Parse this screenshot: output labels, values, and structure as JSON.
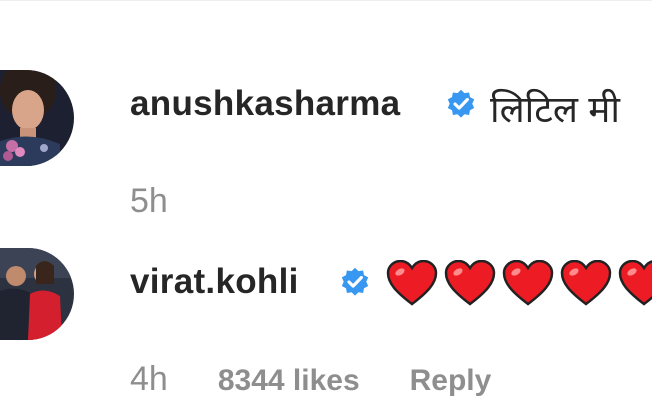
{
  "comments": [
    {
      "username": "anushkasharma",
      "verified": true,
      "text": "लिटिल मी",
      "timestamp": "5h",
      "avatar_icon": "profile-photo-avatar"
    },
    {
      "username": "virat.kohli",
      "verified": true,
      "hearts": [
        "red-heart-icon",
        "red-heart-icon",
        "red-heart-icon",
        "red-heart-icon",
        "red-heart-icon"
      ],
      "timestamp": "4h",
      "likes": "8344 likes",
      "reply_label": "Reply",
      "avatar_icon": "profile-photo-avatar"
    }
  ],
  "colors": {
    "username": "#262626",
    "meta": "#8e8e8e",
    "verified": "#3897f0",
    "heart": "#ed1c24"
  }
}
